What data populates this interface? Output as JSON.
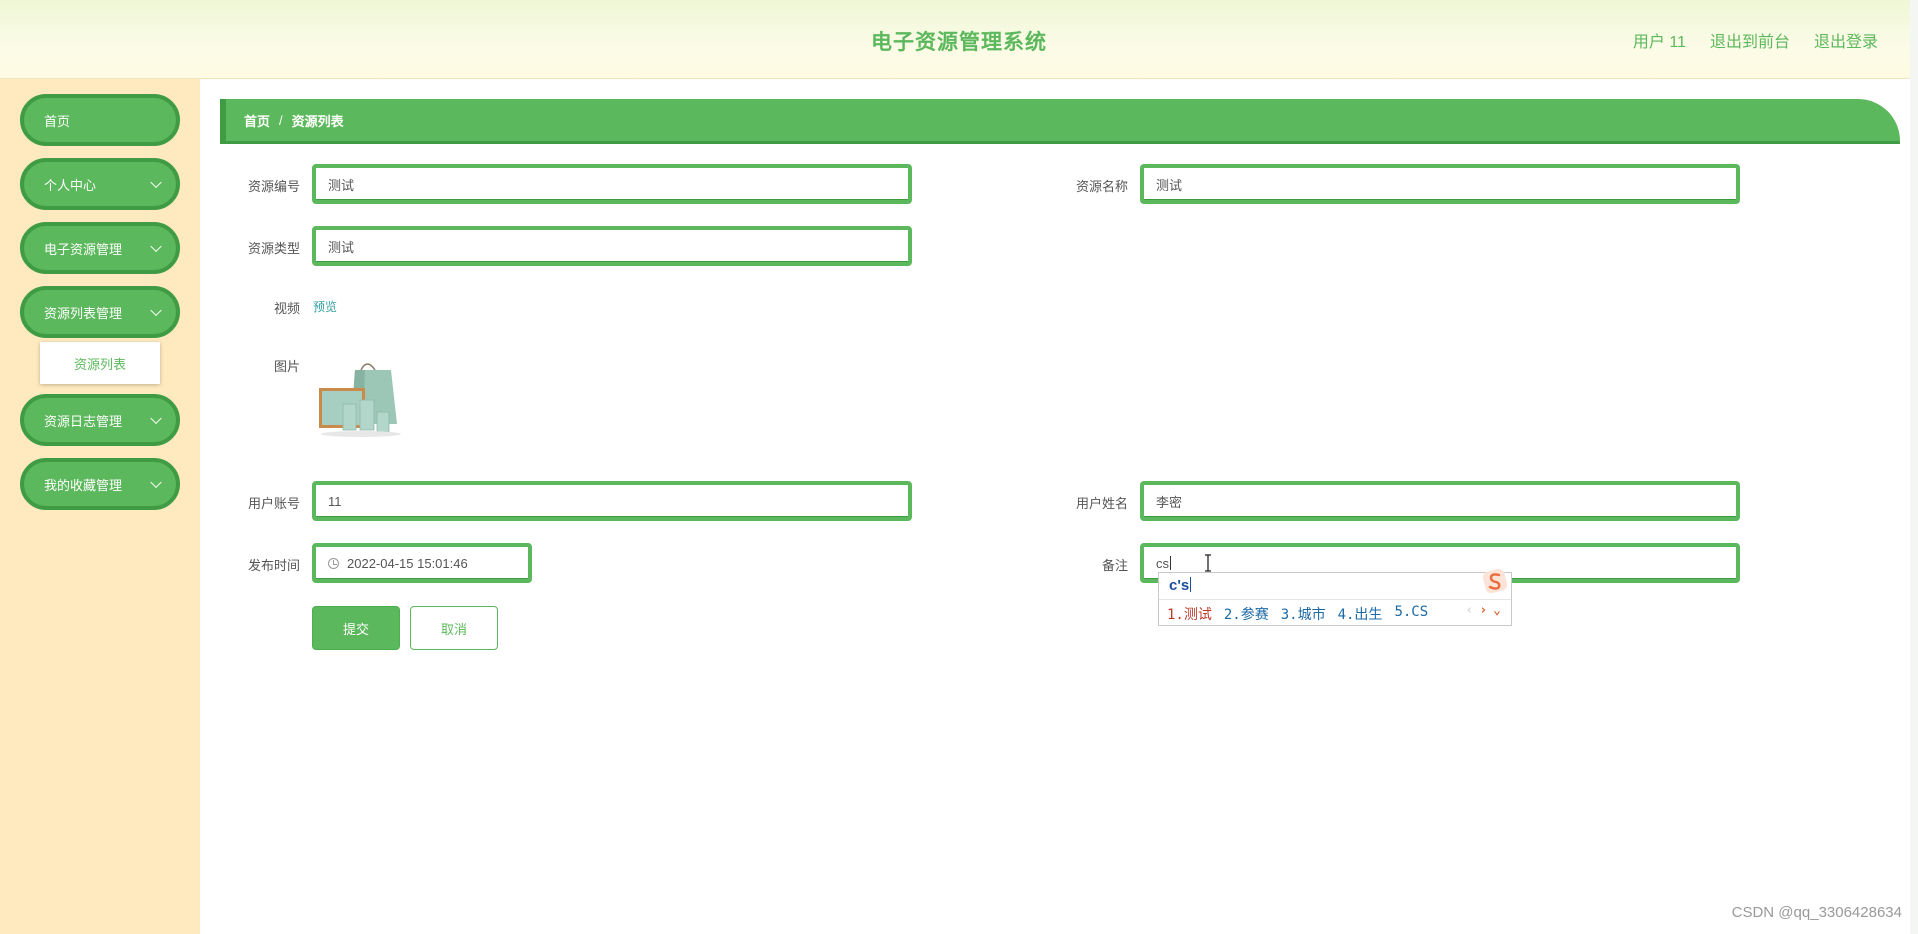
{
  "header": {
    "title": "电子资源管理系统",
    "user_label": "用户 11",
    "to_front": "退出到前台",
    "logout": "退出登录"
  },
  "sidebar": {
    "items": [
      {
        "label": "首页"
      },
      {
        "label": "个人中心"
      },
      {
        "label": "电子资源管理"
      },
      {
        "label": "资源列表管理"
      },
      {
        "label": "资源日志管理"
      },
      {
        "label": "我的收藏管理"
      }
    ],
    "submenu_label": "资源列表"
  },
  "breadcrumb": {
    "home": "首页",
    "sep": "/",
    "current": "资源列表"
  },
  "form": {
    "resource_no_label": "资源编号",
    "resource_no_value": "测试",
    "resource_name_label": "资源名称",
    "resource_name_value": "测试",
    "resource_type_label": "资源类型",
    "resource_type_value": "测试",
    "video_label": "视频",
    "video_link": "预览",
    "image_label": "图片",
    "user_account_label": "用户账号",
    "user_account_value": "11",
    "user_name_label": "用户姓名",
    "user_name_value": "李密",
    "publish_time_label": "发布时间",
    "publish_time_value": "2022-04-15 15:01:46",
    "remark_label": "备注",
    "remark_value": "cs",
    "submit_label": "提交",
    "cancel_label": "取消"
  },
  "ime": {
    "input": "c's",
    "candidates": [
      "1.测试",
      "2.参赛",
      "3.城市",
      "4.出生",
      "5.CS"
    ]
  },
  "watermark": "CSDN @qq_3306428634",
  "colors": {
    "accent": "#5cb85c",
    "accent_dark": "#3f9c44",
    "sidebar_bg": "#ffeabf"
  }
}
